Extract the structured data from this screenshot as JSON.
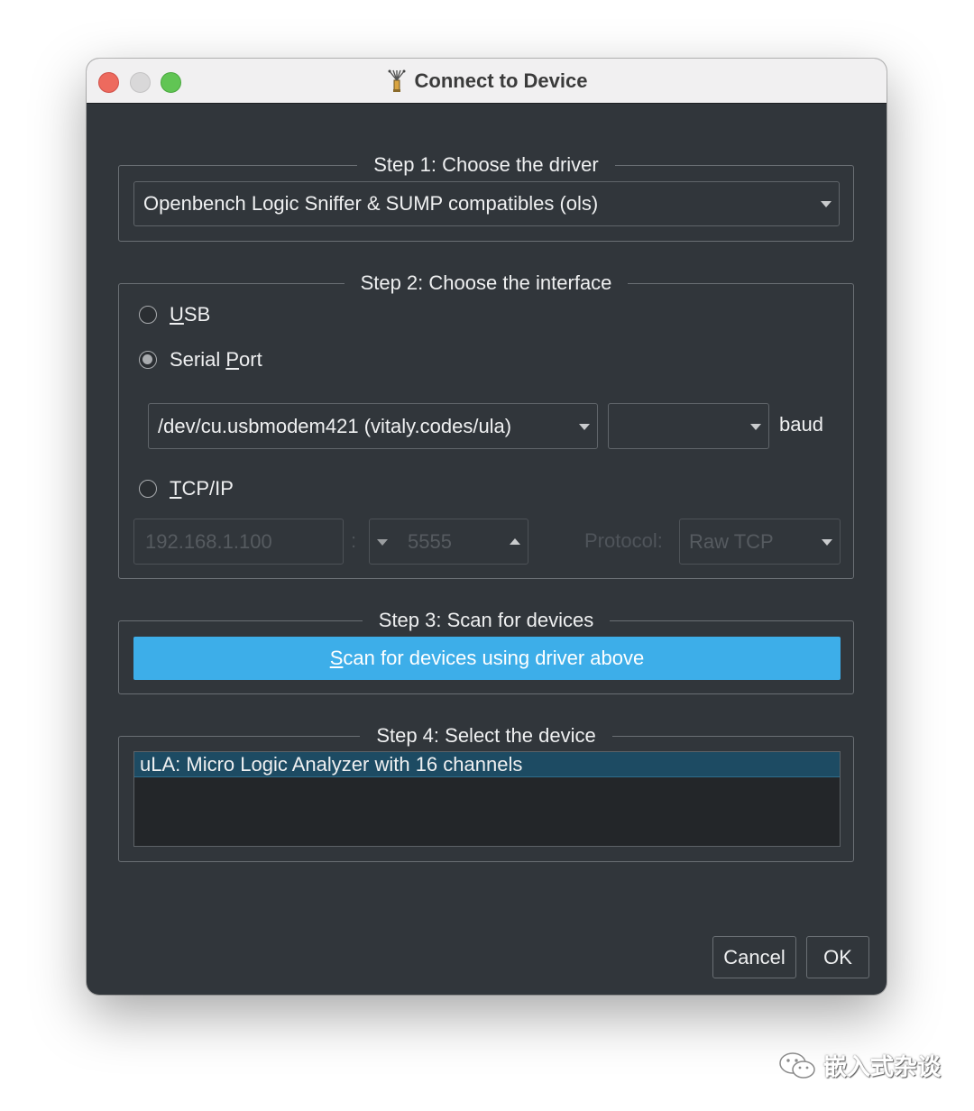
{
  "window": {
    "title": "Connect to Device"
  },
  "step1": {
    "legend": "Step 1: Choose the driver",
    "driver_selected": "Openbench Logic Sniffer & SUMP compatibles (ols)"
  },
  "step2": {
    "legend": "Step 2: Choose the interface",
    "usb": {
      "label_u": "U",
      "label_rest": "SB",
      "checked": false
    },
    "serial": {
      "label_pre": "Serial ",
      "label_u": "P",
      "label_rest": "ort",
      "checked": true
    },
    "serial_port_selected": "/dev/cu.usbmodem421 (vitaly.codes/ula)",
    "baud_selected": "",
    "baud_label": "baud",
    "tcp": {
      "label_u": "T",
      "label_rest": "CP/IP",
      "checked": false
    },
    "tcp_host": "192.168.1.100",
    "tcp_separator": ":",
    "tcp_port": "5555",
    "protocol_label": "Protocol:",
    "protocol_selected": "Raw TCP"
  },
  "step3": {
    "legend": "Step 3: Scan for devices",
    "scan_button_u": "S",
    "scan_button_rest": "can for devices using driver above"
  },
  "step4": {
    "legend": "Step 4: Select the device",
    "devices": [
      "uLA: Micro Logic Analyzer with 16 channels"
    ]
  },
  "buttons": {
    "cancel": "Cancel",
    "ok": "OK"
  },
  "watermark": {
    "text": "嵌入式杂谈"
  },
  "colors": {
    "background": "#31363b",
    "accent": "#3daee9",
    "selection": "#1d4b63"
  }
}
